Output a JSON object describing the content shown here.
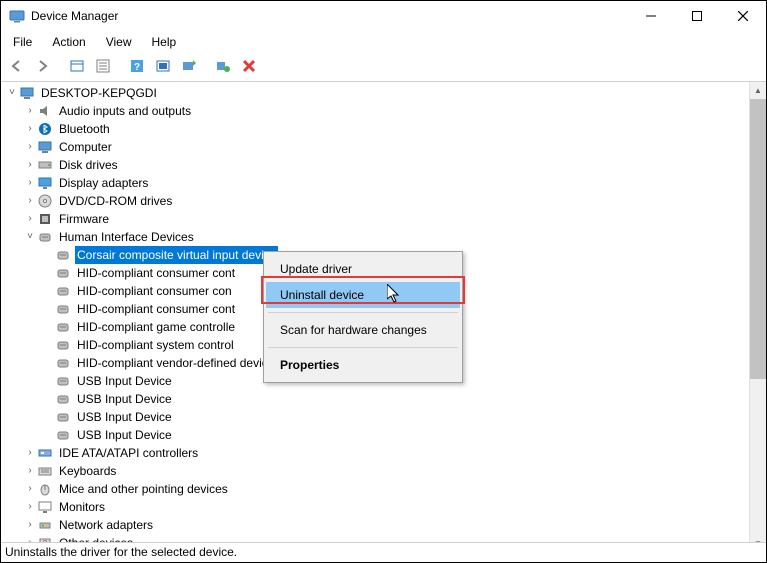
{
  "window": {
    "title": "Device Manager"
  },
  "menu": {
    "file": "File",
    "action": "Action",
    "view": "View",
    "help": "Help"
  },
  "toolbar": {
    "back": "back",
    "forward": "forward",
    "show_hidden": "show-hidden",
    "properties": "properties",
    "help": "help",
    "scan": "scan",
    "update": "update-driver",
    "uninstall": "uninstall",
    "delete": "delete"
  },
  "tree": {
    "root": "DESKTOP-KEPQGDI",
    "nodes": [
      {
        "label": "Audio inputs and outputs",
        "icon": "audio",
        "expand": ">"
      },
      {
        "label": "Bluetooth",
        "icon": "bluetooth",
        "expand": ">"
      },
      {
        "label": "Computer",
        "icon": "computer",
        "expand": ">"
      },
      {
        "label": "Disk drives",
        "icon": "disk",
        "expand": ">"
      },
      {
        "label": "Display adapters",
        "icon": "display",
        "expand": ">"
      },
      {
        "label": "DVD/CD-ROM drives",
        "icon": "cdrom",
        "expand": ">"
      },
      {
        "label": "Firmware",
        "icon": "firmware",
        "expand": ">"
      },
      {
        "label": "Human Interface Devices",
        "icon": "hid",
        "expand": "v"
      },
      {
        "label": "IDE ATA/ATAPI controllers",
        "icon": "ide",
        "expand": ">"
      },
      {
        "label": "Keyboards",
        "icon": "keyboard",
        "expand": ">"
      },
      {
        "label": "Mice and other pointing devices",
        "icon": "mouse",
        "expand": ">"
      },
      {
        "label": "Monitors",
        "icon": "monitor",
        "expand": ">"
      },
      {
        "label": "Network adapters",
        "icon": "network",
        "expand": ">"
      },
      {
        "label": "Other devices",
        "icon": "other",
        "expand": ">"
      }
    ],
    "hid_children": [
      {
        "label": "Corsair composite virtual input device",
        "selected": true
      },
      {
        "label": "HID-compliant consumer cont"
      },
      {
        "label": "HID-compliant consumer con"
      },
      {
        "label": "HID-compliant consumer cont"
      },
      {
        "label": "HID-compliant game controlle"
      },
      {
        "label": "HID-compliant system control"
      },
      {
        "label": "HID-compliant vendor-defined device"
      },
      {
        "label": "USB Input Device"
      },
      {
        "label": "USB Input Device"
      },
      {
        "label": "USB Input Device"
      },
      {
        "label": "USB Input Device"
      }
    ]
  },
  "context_menu": {
    "update": "Update driver",
    "uninstall": "Uninstall device",
    "scan": "Scan for hardware changes",
    "properties": "Properties"
  },
  "statusbar": {
    "text": "Uninstalls the driver for the selected device."
  }
}
